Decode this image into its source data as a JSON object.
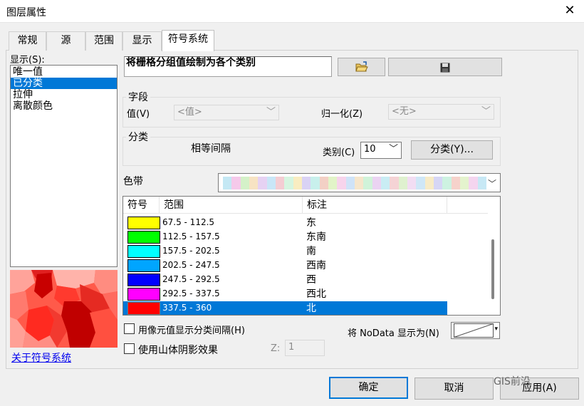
{
  "window": {
    "title": "图层属性",
    "close_glyph": "✕"
  },
  "tabs": [
    {
      "label": "常规"
    },
    {
      "label": "源"
    },
    {
      "label": "范围"
    },
    {
      "label": "显示"
    },
    {
      "label": "符号系统"
    }
  ],
  "show_panel": {
    "label": "显示(S):",
    "items": [
      "唯一值",
      "已分类",
      "拉伸",
      "离散颜色"
    ],
    "selected": "已分类",
    "about_link": "关于符号系统"
  },
  "description": "将栅格分组值绘制为各个类别",
  "field_group": {
    "legend": "字段",
    "value_label": "值(V)",
    "value_combo": "<值>",
    "normalize_label": "归一化(Z)",
    "normalize_combo": "<无>"
  },
  "classification_group": {
    "legend": "分类",
    "method": "相等间隔",
    "classes_label": "类别(C)",
    "classes_value": "10",
    "classify_button": "分类(Y)..."
  },
  "color_ramp": {
    "label": "色带",
    "colors": [
      "#c4e8f4",
      "#f5c9ea",
      "#d4f1c8",
      "#f7e3c3",
      "#e6d2f3",
      "#c9e6f7",
      "#f4cdd3",
      "#d6f5e0",
      "#f9edc1",
      "#d9d2f5",
      "#c8f0ec",
      "#f3d0c5",
      "#e2f4c8",
      "#f7d4ec",
      "#cfe3f8",
      "#f6e6cc",
      "#d0f3d9",
      "#ebd3f2",
      "#c9edf4",
      "#f5d3d5",
      "#dff1cf",
      "#f2ddf3",
      "#cfe7f7",
      "#f7ebc7",
      "#d6d6f5",
      "#cdf2e1",
      "#f6d2cb",
      "#e4f3cd",
      "#f4d5ef",
      "#c7e8f5"
    ]
  },
  "table": {
    "headers": [
      "符号",
      "范围",
      "标注"
    ],
    "rows": [
      {
        "color": "#ffff00",
        "range": "67.5 - 112.5",
        "label": "东"
      },
      {
        "color": "#00ff00",
        "range": "112.5 - 157.5",
        "label": "东南"
      },
      {
        "color": "#00ffff",
        "range": "157.5 - 202.5",
        "label": "南"
      },
      {
        "color": "#00a5ff",
        "range": "202.5 - 247.5",
        "label": "西南"
      },
      {
        "color": "#0000ff",
        "range": "247.5 - 292.5",
        "label": "西"
      },
      {
        "color": "#ff00ff",
        "range": "292.5 - 337.5",
        "label": "西北"
      },
      {
        "color": "#ff0000",
        "range": "337.5 - 360",
        "label": "北"
      }
    ],
    "selected_row": 6
  },
  "options": {
    "pixel_interval_label": "用像元值显示分类间隔(H)",
    "hillshade_label": "使用山体阴影效果",
    "z_label": "Z:",
    "z_value": "1",
    "nodata_label": "将 NoData 显示为(N)"
  },
  "buttons": {
    "ok": "确定",
    "cancel": "取消",
    "apply": "应用(A)"
  },
  "watermark": "GIS前沿",
  "colors": {
    "accent": "#0078d7",
    "link": "#0000ee"
  }
}
